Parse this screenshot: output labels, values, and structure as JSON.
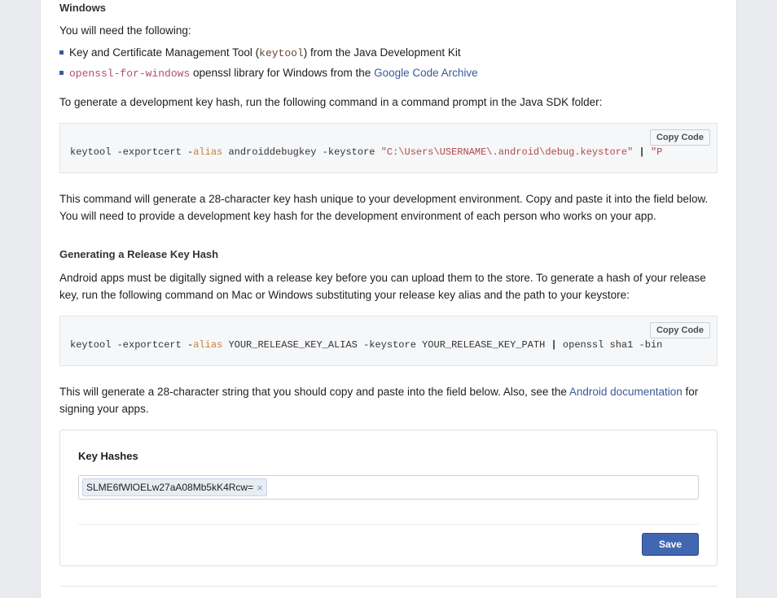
{
  "windows": {
    "heading": "Windows",
    "intro": "You will need the following:",
    "bullets": {
      "b0_pre": "Key and Certificate Management Tool (",
      "b0_code": "keytool",
      "b0_post": ") from the Java Development Kit",
      "b1_code": "openssl-for-windows",
      "b1_mid": " openssl library for Windows from the ",
      "b1_link": "Google Code Archive"
    },
    "generate_dev": "To generate a development key hash, run the following command in a command prompt in the Java SDK folder:"
  },
  "codeblock1": {
    "copy_label": "Copy Code",
    "seg1": "keytool -exportcert -",
    "alias": "alias",
    "seg2": " androiddebugkey -keystore ",
    "str": "\"C:\\Users\\USERNAME\\.android\\debug.keystore\"",
    "pipe": " | ",
    "tail": "\"P"
  },
  "after_cb1": "This command will generate a 28-character key hash unique to your development environment. Copy and paste it into the field below. You will need to provide a development key hash for the development environment of each person who works on your app.",
  "release": {
    "heading": "Generating a Release Key Hash",
    "para": "Android apps must be digitally signed with a release key before you can upload them to the store. To generate a hash of your release key, run the following command on Mac or Windows substituting your release key alias and the path to your keystore:"
  },
  "codeblock2": {
    "copy_label": "Copy Code",
    "seg1": "keytool -exportcert -",
    "alias": "alias",
    "seg2": " YOUR_RELEASE_KEY_ALIAS -keystore YOUR_RELEASE_KEY_PATH ",
    "pipe": "|",
    "seg3": " openssl sha1 -bin"
  },
  "after_cb2": {
    "pre": "This will generate a 28-character string that you should copy and paste into the field below. Also, see the ",
    "link": "Android documentation",
    "post": " for signing your apps."
  },
  "card": {
    "title": "Key Hashes",
    "tag_value": "SLME6fWlOELw27aA08Mb5kK4Rcw=",
    "save_label": "Save"
  }
}
